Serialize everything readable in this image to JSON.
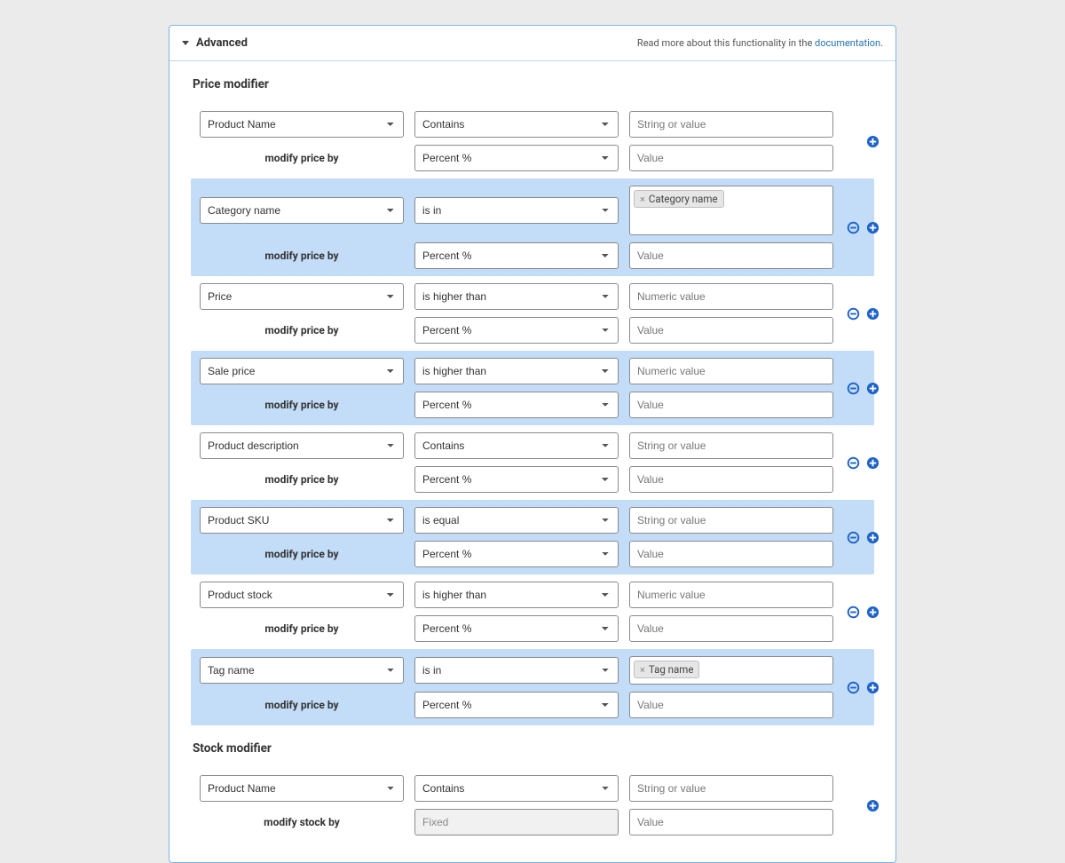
{
  "panel": {
    "title": "Advanced",
    "help_prefix": "Read more about this functionality in the ",
    "help_link": "documentation",
    "help_suffix": "."
  },
  "sections": {
    "price": {
      "title": "Price modifier",
      "modify_label": "modify price by"
    },
    "stock": {
      "title": "Stock modifier",
      "modify_label": "modify stock by"
    }
  },
  "placeholders": {
    "string": "String or value",
    "numeric": "Numeric value",
    "value": "Value"
  },
  "mod_types": {
    "percent": "Percent %",
    "fixed": "Fixed"
  },
  "price_rules": [
    {
      "field": "Product Name",
      "op": "Contains",
      "value_kind": "string",
      "mod_type": "percent",
      "actions": "add"
    },
    {
      "field": "Category name",
      "op": "is in",
      "value_kind": "tag_tall",
      "tag": "Category name",
      "mod_type": "percent",
      "actions": "both"
    },
    {
      "field": "Price",
      "op": "is higher than",
      "value_kind": "numeric",
      "mod_type": "percent",
      "actions": "both"
    },
    {
      "field": "Sale price",
      "op": "is higher than",
      "value_kind": "numeric",
      "mod_type": "percent",
      "actions": "both"
    },
    {
      "field": "Product description",
      "op": "Contains",
      "value_kind": "string",
      "mod_type": "percent",
      "actions": "both"
    },
    {
      "field": "Product SKU",
      "op": "is equal",
      "value_kind": "string",
      "mod_type": "percent",
      "actions": "both"
    },
    {
      "field": "Product stock",
      "op": "is higher than",
      "value_kind": "numeric",
      "mod_type": "percent",
      "actions": "both"
    },
    {
      "field": "Tag name",
      "op": "is in",
      "value_kind": "tag",
      "tag": "Tag name",
      "mod_type": "percent",
      "actions": "both"
    }
  ],
  "stock_rules": [
    {
      "field": "Product Name",
      "op": "Contains",
      "value_kind": "string",
      "mod_type": "fixed_disabled",
      "actions": "add"
    }
  ]
}
